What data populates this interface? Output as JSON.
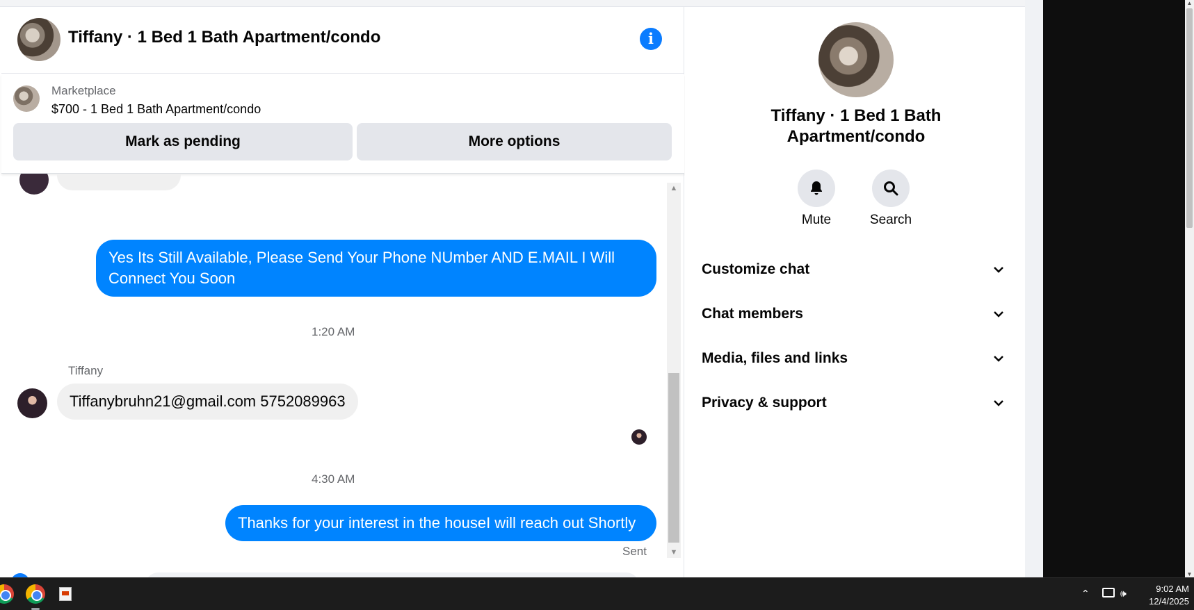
{
  "chat": {
    "title": "Tiffany · 1 Bed 1 Bath Apartment/condo",
    "marketplace": {
      "label": "Marketplace",
      "listing": "$700 - 1 Bed 1 Bath Apartment/condo",
      "mark_pending": "Mark as pending",
      "more_options": "More options"
    },
    "messages": {
      "out1": "Yes Its Still Available, Please Send Your Phone NUmber AND E.MAIL I Will Connect You Soon",
      "time1": "1:20 AM",
      "sender": "Tiffany",
      "in1": "Tiffanybruhn21@gmail.com 5752089963",
      "time2": "4:30 AM",
      "out2": "Thanks for your interest in the houseI will reach out Shortly",
      "status": "Sent"
    }
  },
  "panel": {
    "title": "Tiffany · 1 Bed 1 Bath Apartment/condo",
    "mute": "Mute",
    "search": "Search",
    "sections": [
      "Customize chat",
      "Chat members",
      "Media, files and links",
      "Privacy & support"
    ]
  },
  "taskbar": {
    "time": "9:02 AM",
    "date": "12/4/2025"
  },
  "colors": {
    "accent": "#0084ff",
    "info_icon": "#0a7cff",
    "button_gray": "#e4e6eb"
  }
}
